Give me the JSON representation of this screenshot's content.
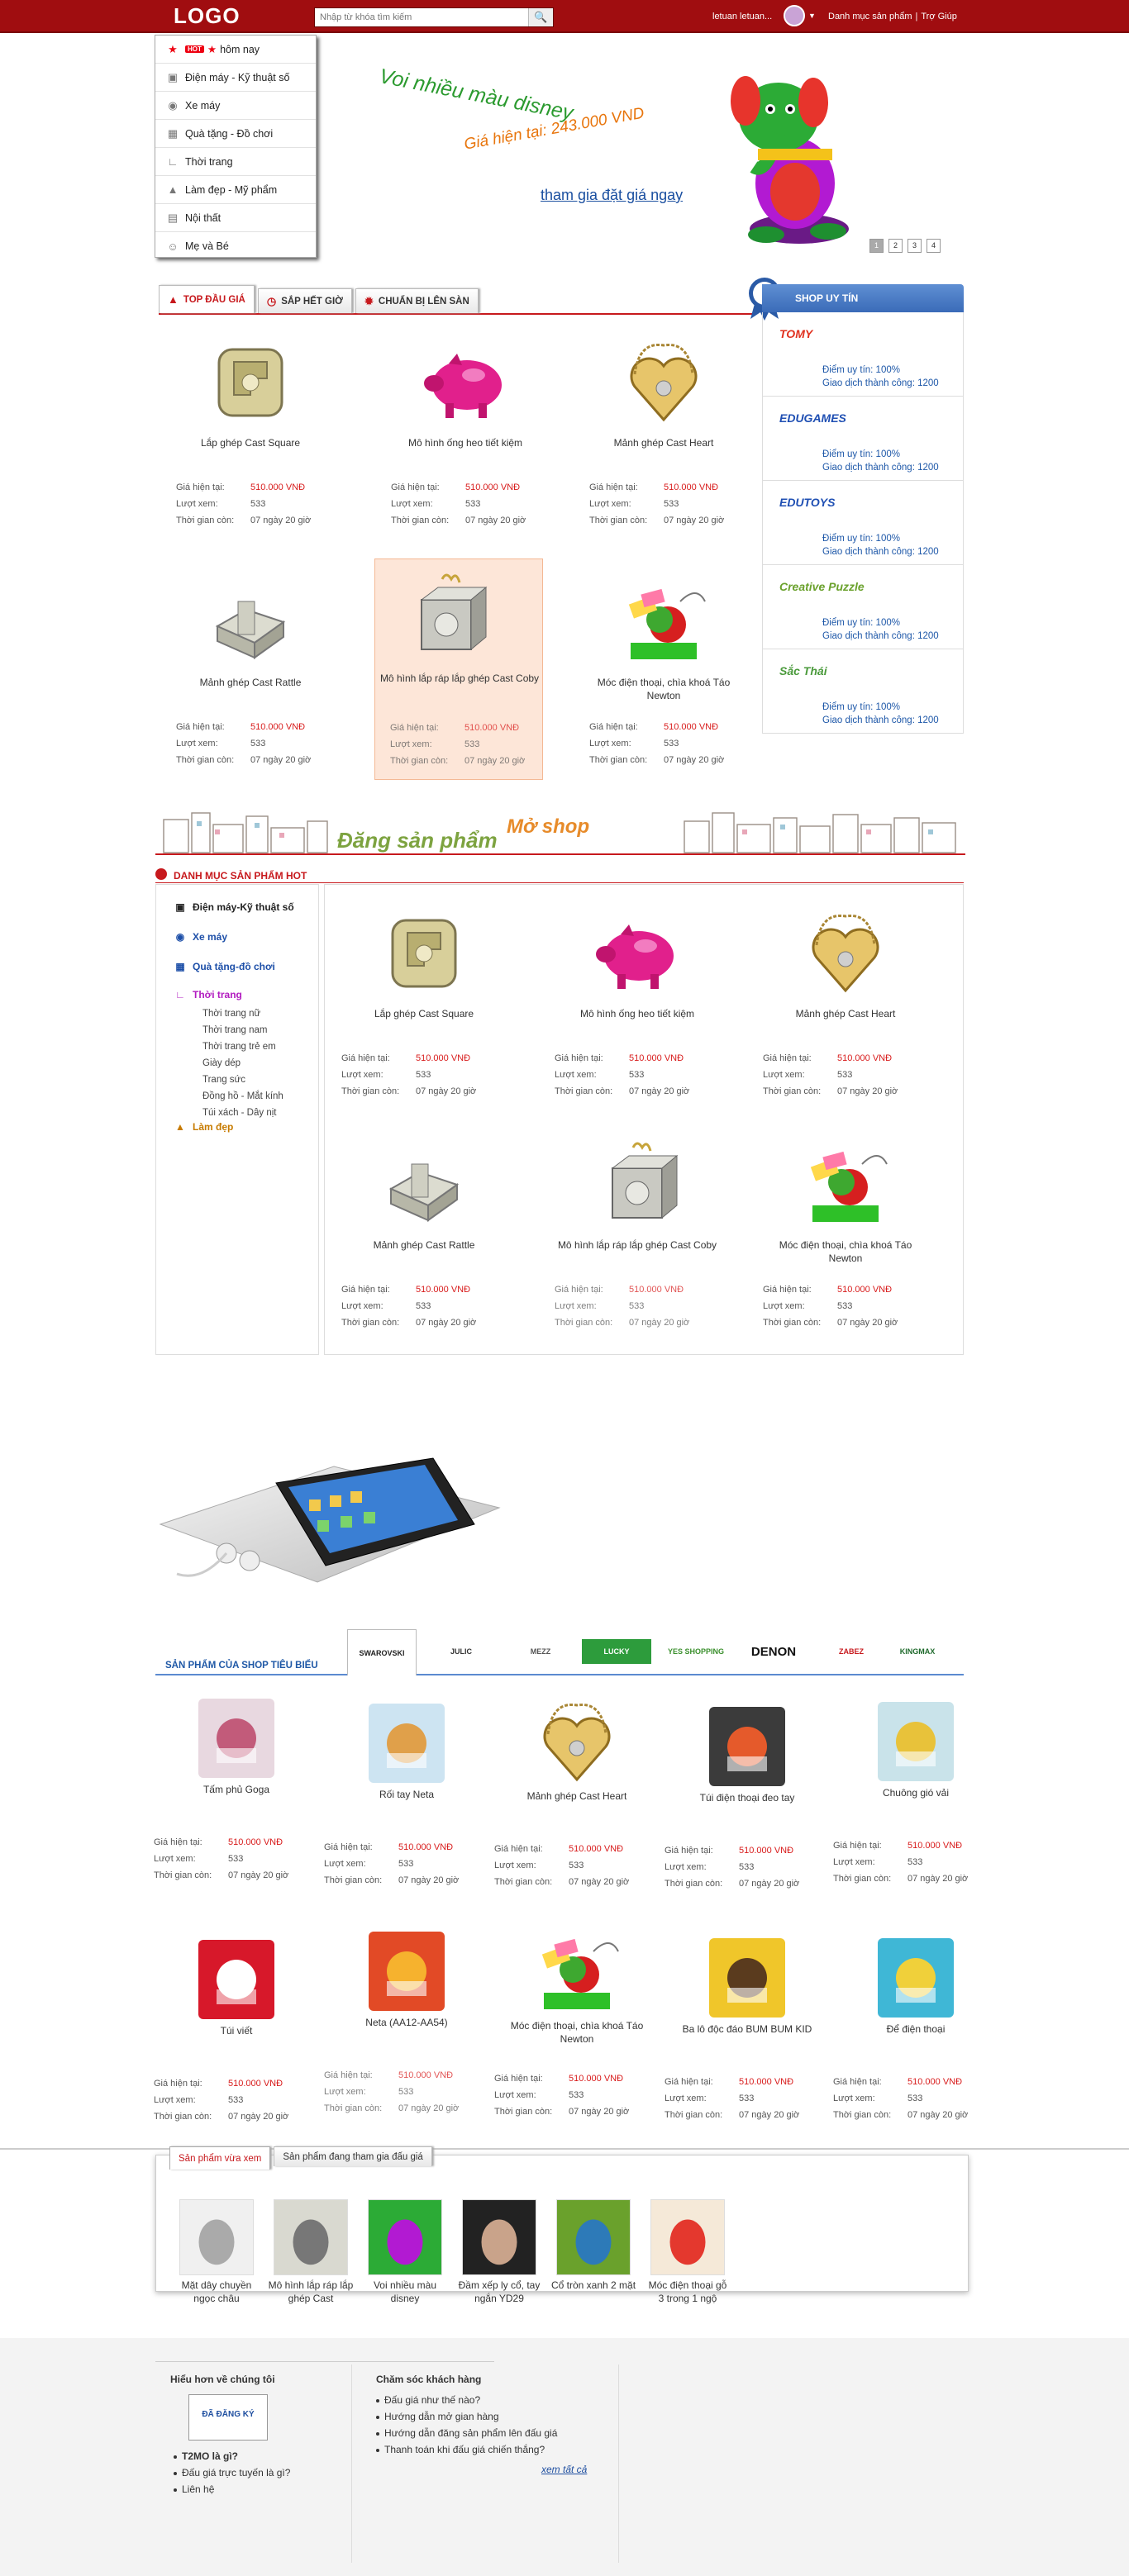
{
  "header": {
    "logo": "LOGO",
    "search_placeholder": "Nhập từ khóa tìm kiếm",
    "username": "letuan letuan...",
    "links": [
      "Danh mục sản phẩm",
      "Trợ Giúp"
    ]
  },
  "categories": [
    {
      "label": "hôm nay",
      "badge": "HOT",
      "icon": "star-icon"
    },
    {
      "label": "Điện máy - Kỹ thuật số",
      "icon": "camera-icon"
    },
    {
      "label": "Xe máy",
      "icon": "motorbike-icon"
    },
    {
      "label": "Quà tặng - Đồ chơi",
      "icon": "gift-icon"
    },
    {
      "label": "Thời trang",
      "icon": "shoe-icon"
    },
    {
      "label": "Làm đẹp - Mỹ phẩm",
      "icon": "lipstick-icon"
    },
    {
      "label": "Nội thất",
      "icon": "sofa-icon"
    },
    {
      "label": "Mẹ và Bé",
      "icon": "baby-icon"
    }
  ],
  "banner": {
    "title": "Voi nhiều màu disney",
    "price": "Giá hiện tại: 243.000 VND",
    "cta": "tham gia đặt giá ngay",
    "pages": [
      "1",
      "2",
      "3",
      "4"
    ]
  },
  "tabs": [
    "TOP ĐẦU GIÁ",
    "SẮP HẾT GIỜ",
    "CHUẨN BỊ LÊN SÀN"
  ],
  "meta_labels": {
    "price": "Giá hiện tại:",
    "views": "Lượt xem:",
    "time": "Thời gian còn:"
  },
  "products": [
    {
      "name": "Lắp ghép Cast Square",
      "price": "510.000 VNĐ",
      "views": "533",
      "time": "07 ngày 20 giờ",
      "img": "cast-square"
    },
    {
      "name": "Mô hình ống heo tiết kiệm",
      "price": "510.000 VNĐ",
      "views": "533",
      "time": "07 ngày 20 giờ",
      "img": "piggy"
    },
    {
      "name": "Mảnh ghép Cast Heart",
      "price": "510.000 VNĐ",
      "views": "533",
      "time": "07 ngày 20 giờ",
      "img": "heart"
    },
    {
      "name": "Mảnh ghép Cast Rattle",
      "price": "510.000 VNĐ",
      "views": "533",
      "time": "07 ngày 20 giờ",
      "img": "rattle"
    },
    {
      "name": "Mô hình lắp ráp lắp ghép Cast Coby",
      "price": "510.000 VNĐ",
      "views": "533",
      "time": "07 ngày 20 giờ",
      "img": "coby"
    },
    {
      "name": "Móc điện thoại, chìa khoá Táo Newton",
      "price": "510.000 VNĐ",
      "views": "533",
      "time": "07 ngày 20 giờ",
      "img": "apple"
    }
  ],
  "shops": {
    "title": "SHOP UY TÍN",
    "items": [
      {
        "name": "TOMY",
        "color": "#e0301e",
        "rating": "Điểm uy tín: 100%",
        "deals": "Giao dịch thành công: 1200"
      },
      {
        "name": "EDUGAMES",
        "color": "#1f4fb3",
        "rating": "Điểm uy tín: 100%",
        "deals": "Giao dịch thành công: 1200"
      },
      {
        "name": "EDUTOYS",
        "color": "#1f4fb3",
        "rating": "Điểm uy tín: 100%",
        "deals": "Giao dịch thành công: 1200"
      },
      {
        "name": "Creative Puzzle",
        "color": "#6aa12c",
        "rating": "Điểm uy tín: 100%",
        "deals": "Giao dịch thành công: 1200"
      },
      {
        "name": "Sắc Thái",
        "color": "#4a9a3b",
        "rating": "Điểm uy tín: 100%",
        "deals": "Giao dịch thành công: 1200"
      }
    ]
  },
  "promo": {
    "left": "Đăng sản phẩm",
    "right": "Mở shop"
  },
  "hot_section": {
    "title": "DANH MỤC SẢN PHẨM HOT",
    "cats": [
      {
        "label": "Điện máy-Kỹ thuật số",
        "color": "#222",
        "icon": "camera-icon"
      },
      {
        "label": "Xe máy",
        "color": "#1d4fa8",
        "icon": "motorbike-icon"
      },
      {
        "label": "Quà tặng-đồ chơi",
        "color": "#1d4fa8",
        "icon": "gift-icon"
      },
      {
        "label": "Thời trang",
        "color": "#b21cc0",
        "icon": "shoe-icon"
      },
      {
        "label": "Làm đẹp",
        "color": "#c77b00",
        "icon": "lipstick-icon"
      }
    ],
    "subs": [
      "Thời trang nữ",
      "Thời trang nam",
      "Thời trang trẻ em",
      "Giày dép",
      "Trang sức",
      "Đồng hồ - Mắt kính",
      "Túi xách - Dây nịt"
    ]
  },
  "shop_products": {
    "title": "SẢN PHẨM CỦA SHOP TIÊU BIỂU",
    "brands": [
      "SWAROVSKI",
      "JULIC",
      "MEZZ",
      "LUCKY",
      "YES SHOPPING",
      "DENON",
      "ZABEZ",
      "KINGMAX"
    ],
    "items": [
      {
        "name": "Tấm phủ Goga",
        "price": "510.000 VNĐ",
        "views": "533",
        "time": "07 ngày 20 giờ"
      },
      {
        "name": "Rối tay Neta",
        "price": "510.000 VNĐ",
        "views": "533",
        "time": "07 ngày 20 giờ"
      },
      {
        "name": "Mảnh ghép Cast Heart",
        "price": "510.000 VNĐ",
        "views": "533",
        "time": "07 ngày 20 giờ"
      },
      {
        "name": "Túi điện thoại đeo tay",
        "price": "510.000 VNĐ",
        "views": "533",
        "time": "07 ngày 20 giờ"
      },
      {
        "name": "Chuông gió vải",
        "price": "510.000 VNĐ",
        "views": "533",
        "time": "07 ngày 20 giờ"
      },
      {
        "name": "Túi viết",
        "price": "510.000 VNĐ",
        "views": "533",
        "time": "07 ngày 20 giờ"
      },
      {
        "name": "Neta (AA12-AA54)",
        "price": "510.000 VNĐ",
        "views": "533",
        "time": "07 ngày 20 giờ"
      },
      {
        "name": "Móc điện thoại, chìa khoá Táo Newton",
        "price": "510.000 VNĐ",
        "views": "533",
        "time": "07 ngày 20 giờ"
      },
      {
        "name": "Ba lô độc đáo BUM BUM KID",
        "price": "510.000 VNĐ",
        "views": "533",
        "time": "07 ngày 20 giờ"
      },
      {
        "name": "Để điện thoại",
        "price": "510.000 VNĐ",
        "views": "533",
        "time": "07 ngày 20 giờ"
      }
    ]
  },
  "recent": {
    "tabs": [
      "Sản phẩm vừa xem",
      "Sản phẩm đang tham gia đấu giá"
    ],
    "items": [
      "Mặt dây chuyền ngọc châu",
      "Mô hình lắp ráp lắp ghép Cast",
      "Voi nhiều màu disney",
      "Đầm xếp ly cổ, tay ngắn YD29",
      "Cổ tròn xanh 2 mặt",
      "Móc điện thoại gỗ 3 trong 1 ngộ"
    ]
  },
  "footer": {
    "about_title": "Hiểu hơn về chúng tôi",
    "badge": "ĐÃ ĐĂNG KÝ",
    "about_links": [
      "T2MO là gì?",
      "Đấu giá trực tuyến là gì?",
      "Liên hệ"
    ],
    "care_title": "Chăm sóc khách hàng",
    "care_links": [
      "Đấu giá như thế nào?",
      "Hướng dẫn mở gian hàng",
      "Hướng dẫn đăng sản phẩm lên đấu giá",
      "Thanh toán khi đấu giá chiến thắng?"
    ],
    "see_all": "xem tất cả"
  }
}
